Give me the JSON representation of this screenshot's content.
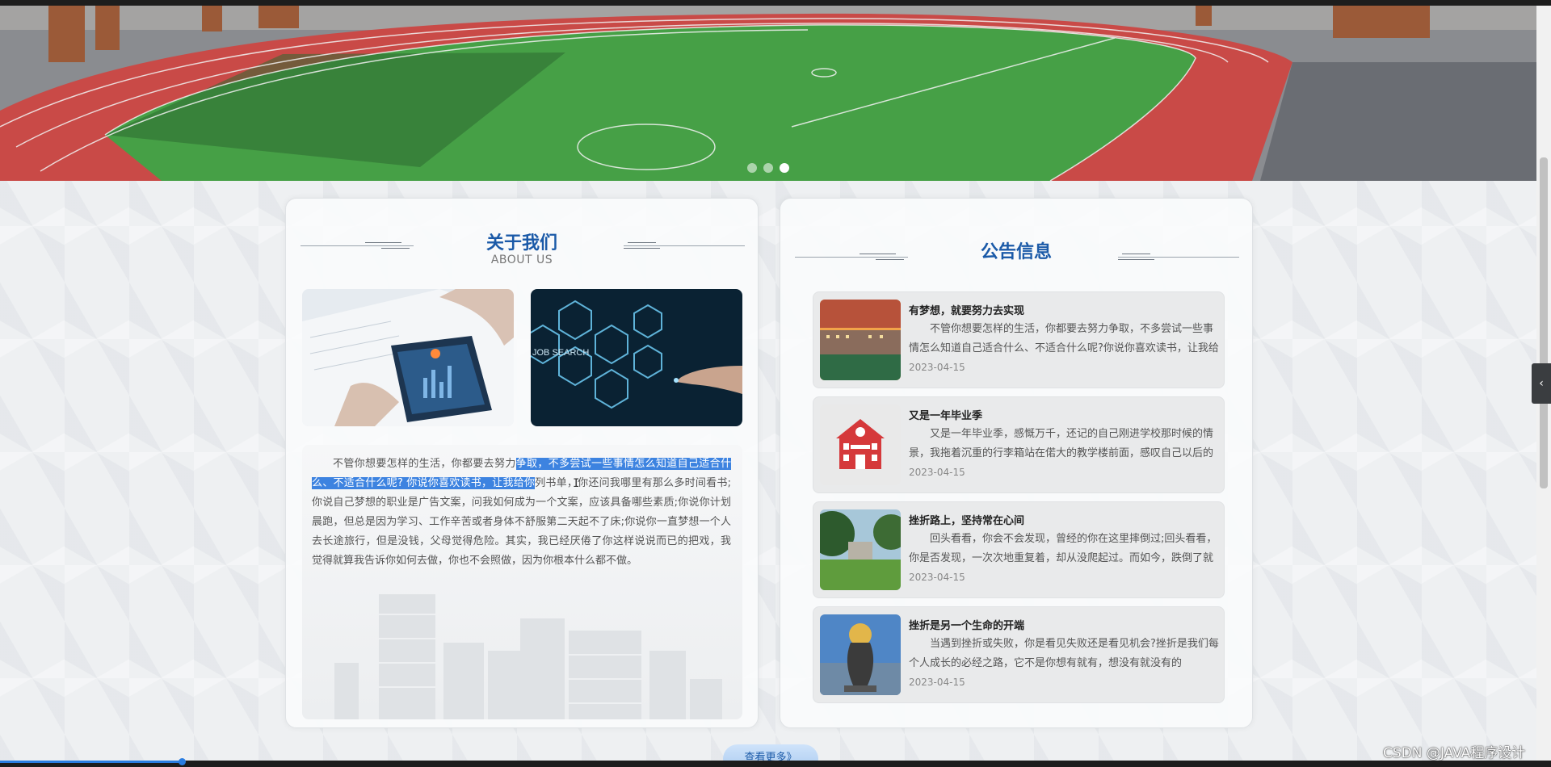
{
  "banner": {
    "slide_count": 3,
    "active_slide": 3
  },
  "about": {
    "title": "关于我们",
    "subtitle": "ABOUT US",
    "text_before": "不管你想要怎样的生活，你都要去努力",
    "text_selected": "争取，不多尝试一些事情怎么知道自己适合什么、不适合什么呢? 你说你喜欢读书，让我给你",
    "text_after": "列书单，你还问我哪里有那么多时间看书;你说自己梦想的职业是广告文案，问我如何成为一个文案，应该具备哪些素质;你说你计划晨跑，但总是因为学习、工作辛苦或者身体不舒服第二天起不了床;你说你一直梦想一个人去长途旅行，但是没钱，父母觉得危险。其实，我已经厌倦了你这样说说而已的把戏，我觉得就算我告诉你如何去做，你也不会照做，因为你根本什么都不做。",
    "image_right_label": "JOB SEARCH"
  },
  "notice": {
    "title": "公告信息",
    "items": [
      {
        "title": "有梦想，就要努力去实现",
        "desc": "不管你想要怎样的生活，你都要去努力争取，不多尝试一些事情怎么知道自己适合什么、不适合什么呢?你说你喜欢读书，让我给你列书单",
        "date": "2023-04-15",
        "thumb": "campus-sunset"
      },
      {
        "title": "又是一年毕业季",
        "desc": "又是一年毕业季，感慨万千，还记的自己刚进学校那时候的情景，我拖着沉重的行李箱站在偌大的教学楼前面，感叹自己以后的生活",
        "date": "2023-04-15",
        "thumb": "school-building-icon"
      },
      {
        "title": "挫折路上，坚持常在心间",
        "desc": "回头看看，你会不会发现，曾经的你在这里摔倒过;回头看看，你是否发现，一次次地重复着，却从没爬起过。而如今，跌倒了就要爬起来",
        "date": "2023-04-15",
        "thumb": "campus-lawn"
      },
      {
        "title": "挫折是另一个生命的开端",
        "desc": "当遇到挫折或失败，你是看见失败还是看见机会?挫折是我们每个人成长的必经之路，它不是你想有就有，想没有就没有的",
        "date": "2023-04-15",
        "thumb": "globe-sculpture"
      }
    ]
  },
  "more_button": "查看更多》",
  "watermark": "CSDN @JAVA程序设计",
  "sidebar_tab_icon": "chevron-left-icon",
  "video_progress_percent": 11.7,
  "colors": {
    "accent": "#1b5aa8",
    "selection": "#3d83e0",
    "track": "#d8494a",
    "field": "#3d8b3d"
  }
}
